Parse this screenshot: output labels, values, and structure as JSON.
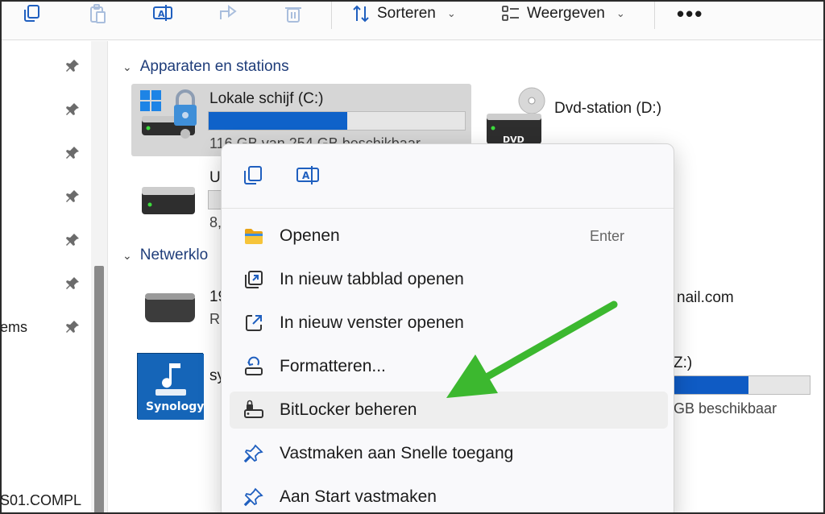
{
  "toolbar": {
    "sort_label": "Sorteren",
    "view_label": "Weergeven",
    "more_label": "•••"
  },
  "nav": {
    "partial_item": "ems",
    "partial_bottom": "S01.COMPL"
  },
  "groups": {
    "devices": "Apparaten en stations",
    "network": "Netwerklo"
  },
  "drives": {
    "c": {
      "name": "Lokale schijf (C:)",
      "sub": "116 GB van 254 GB beschikbaar",
      "used_fraction": 0.54
    },
    "dvd": {
      "name": "Dvd-station (D:)",
      "label": "DVD"
    },
    "usb": {
      "name": "U",
      "sub": "8,"
    },
    "net1": {
      "name": "19",
      "sub": "R",
      "right_text": "nail.com"
    },
    "syn": {
      "name": "sy",
      "logo": "Synology"
    },
    "z": {
      "name": "Z:)",
      "sub": "GB beschikbaar",
      "used_fraction": 0.55
    }
  },
  "context_menu": {
    "items": [
      {
        "label": "Openen",
        "shortcut": "Enter",
        "icon": "folder-icon"
      },
      {
        "label": "In nieuw tabblad openen",
        "icon": "new-tab-icon"
      },
      {
        "label": "In nieuw venster openen",
        "icon": "new-window-icon"
      },
      {
        "label": "Formatteren...",
        "icon": "format-icon"
      },
      {
        "label": "BitLocker beheren",
        "icon": "bitlocker-icon"
      },
      {
        "label": "Vastmaken aan Snelle toegang",
        "icon": "pin-icon"
      },
      {
        "label": "Aan Start vastmaken",
        "icon": "pin-start-icon"
      }
    ]
  },
  "colors": {
    "accent_blue": "#0f62c9",
    "annotation_green": "#3cb82f",
    "header_blue": "#1f3d7a"
  }
}
